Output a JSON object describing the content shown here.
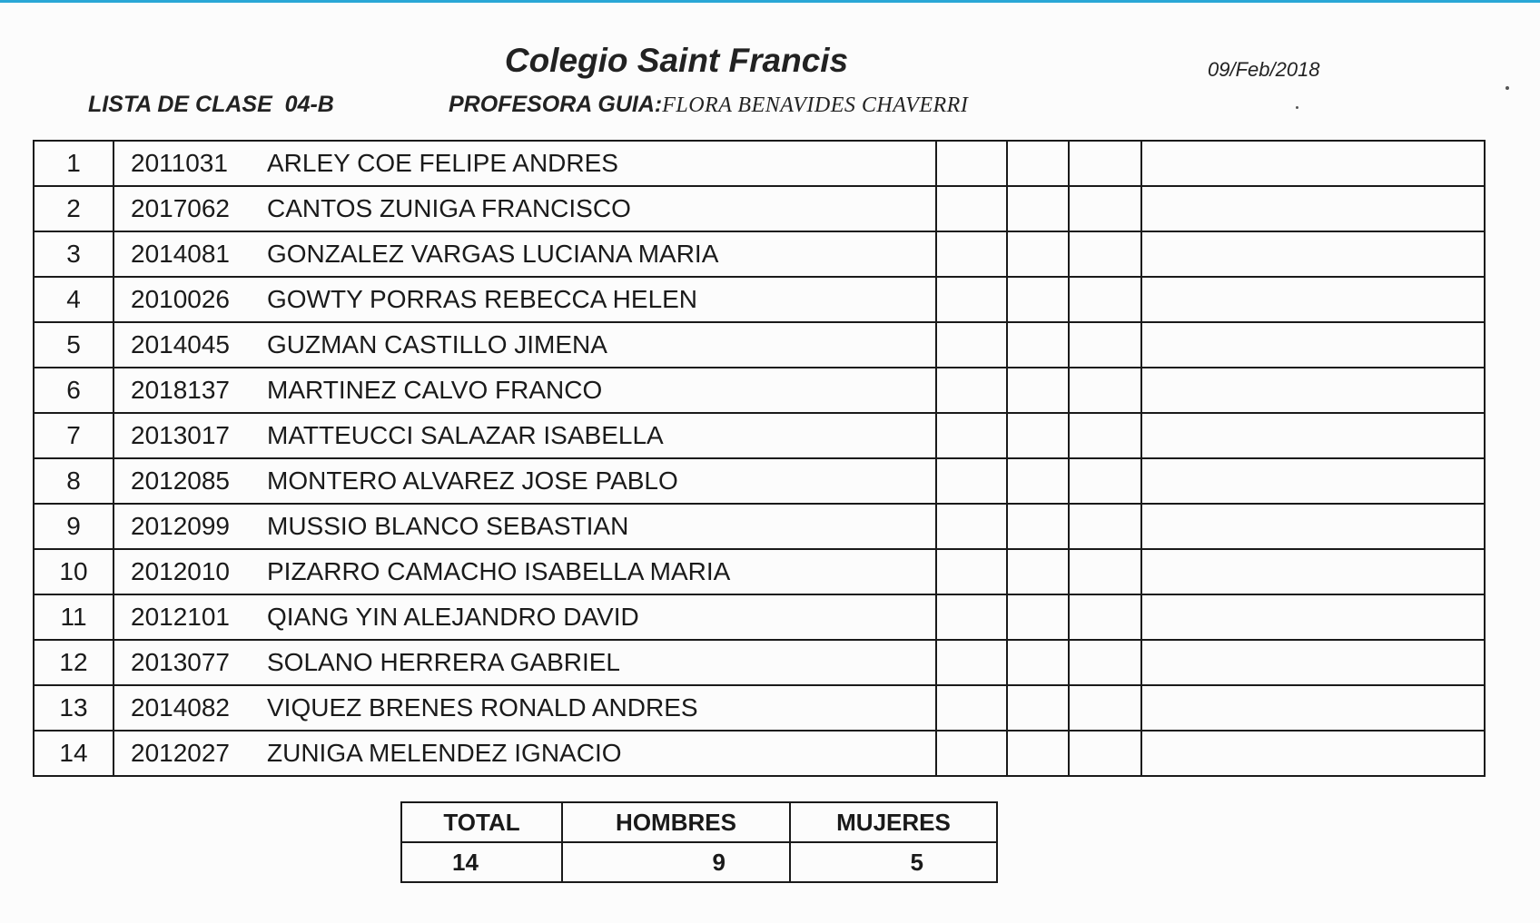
{
  "header": {
    "school": "Colegio Saint Francis",
    "date": "09/Feb/2018",
    "class_list": "LISTA DE CLASE  04-B",
    "teacher_label": "PROFESORA GUIA:",
    "teacher_name": "FLORA BENAVIDES CHAVERRI"
  },
  "students": [
    {
      "n": "1",
      "id": "2011031",
      "name": "ARLEY COE FELIPE ANDRES"
    },
    {
      "n": "2",
      "id": "2017062",
      "name": "CANTOS ZUNIGA FRANCISCO"
    },
    {
      "n": "3",
      "id": "2014081",
      "name": "GONZALEZ VARGAS LUCIANA MARIA"
    },
    {
      "n": "4",
      "id": "2010026",
      "name": "GOWTY PORRAS REBECCA HELEN"
    },
    {
      "n": "5",
      "id": "2014045",
      "name": "GUZMAN CASTILLO JIMENA"
    },
    {
      "n": "6",
      "id": "2018137",
      "name": "MARTINEZ CALVO FRANCO"
    },
    {
      "n": "7",
      "id": "2013017",
      "name": "MATTEUCCI SALAZAR ISABELLA"
    },
    {
      "n": "8",
      "id": "2012085",
      "name": "MONTERO ALVAREZ JOSE PABLO"
    },
    {
      "n": "9",
      "id": "2012099",
      "name": "MUSSIO BLANCO SEBASTIAN"
    },
    {
      "n": "10",
      "id": "2012010",
      "name": "PIZARRO CAMACHO ISABELLA MARIA"
    },
    {
      "n": "11",
      "id": "2012101",
      "name": "QIANG YIN ALEJANDRO DAVID"
    },
    {
      "n": "12",
      "id": "2013077",
      "name": "SOLANO HERRERA GABRIEL"
    },
    {
      "n": "13",
      "id": "2014082",
      "name": "VIQUEZ BRENES RONALD ANDRES"
    },
    {
      "n": "14",
      "id": "2012027",
      "name": "ZUNIGA MELENDEZ IGNACIO"
    }
  ],
  "totals": {
    "total_label": "TOTAL",
    "men_label": "HOMBRES",
    "women_label": "MUJERES",
    "total": "14",
    "men": "9",
    "women": "5"
  }
}
